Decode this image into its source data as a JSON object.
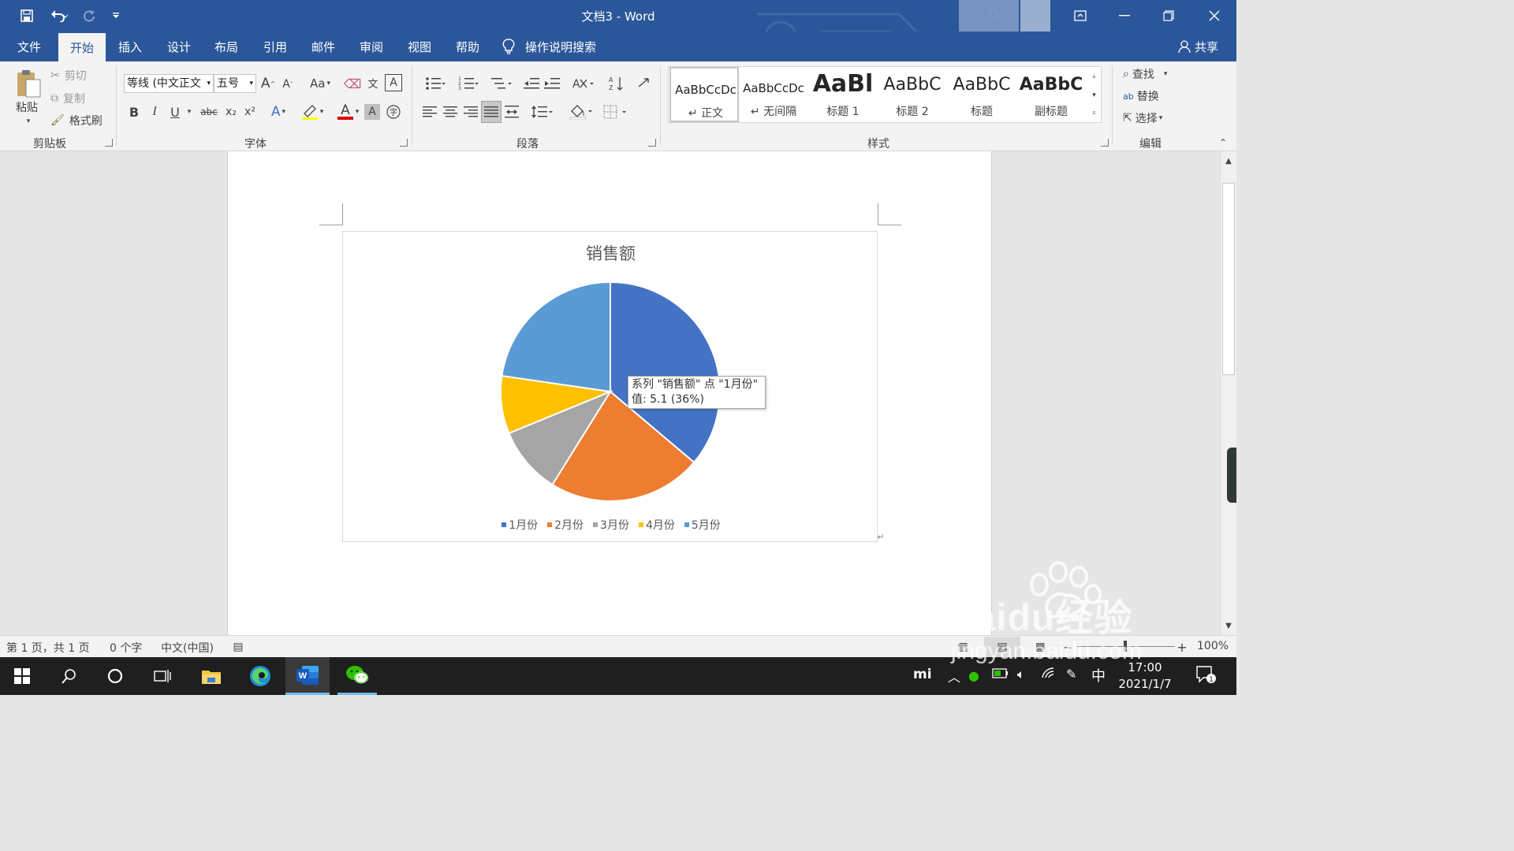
{
  "window": {
    "title": "文档3  -  Word",
    "qat": {
      "save_icon": "save-icon",
      "undo_icon": "undo-icon",
      "redo_icon": "redo-icon",
      "customize_icon": "chevron-down-icon"
    },
    "controls": {
      "ribbon_display": "ribbon-display-icon",
      "minimize": "minimize-icon",
      "restore": "restore-icon",
      "close": "close-icon"
    }
  },
  "tabs": [
    {
      "label": "文件"
    },
    {
      "label": "开始"
    },
    {
      "label": "插入"
    },
    {
      "label": "设计"
    },
    {
      "label": "布局"
    },
    {
      "label": "引用"
    },
    {
      "label": "邮件"
    },
    {
      "label": "审阅"
    },
    {
      "label": "视图"
    },
    {
      "label": "帮助"
    }
  ],
  "tell_me": "操作说明搜索",
  "share": "共享",
  "ribbon": {
    "clipboard": {
      "paste": "粘贴",
      "cut": "剪切",
      "copy": "复制",
      "format_painter": "格式刷",
      "label": "剪贴板"
    },
    "font": {
      "name": "等线 (中文正文",
      "size": "五号",
      "label": "字体",
      "bold": "B",
      "italic": "I",
      "underline": "U",
      "strike": "abc",
      "sub": "x₂",
      "sup": "x²",
      "change_case": "Aa",
      "grow": "A",
      "shrink": "A",
      "font_color_accent": "#e00000"
    },
    "paragraph": {
      "label": "段落"
    },
    "styles": {
      "label": "样式",
      "items": [
        {
          "sample": "AaBbCcDc",
          "name": "↵ 正文"
        },
        {
          "sample": "AaBbCcDc",
          "name": "↵ 无间隔"
        },
        {
          "sample": "AaBl",
          "name": "标题 1"
        },
        {
          "sample": "AaBbC",
          "name": "标题 2"
        },
        {
          "sample": "AaBbC",
          "name": "标题"
        },
        {
          "sample": "AaBbC",
          "name": "副标题"
        }
      ]
    },
    "editing": {
      "label": "编辑",
      "find": "查找",
      "replace": "替换",
      "select": "选择"
    }
  },
  "chart_data": {
    "type": "pie",
    "title": "销售额",
    "categories": [
      "1月份",
      "2月份",
      "3月份",
      "4月份",
      "5月份"
    ],
    "series": [
      {
        "name": "销售额",
        "values": [
          5.1,
          3.2,
          1.4,
          1.2,
          3.2
        ]
      }
    ],
    "colors": [
      "#4472c4",
      "#ed7d31",
      "#a5a5a5",
      "#ffc000",
      "#5b9bd5"
    ],
    "legend": "bottom",
    "tooltip": {
      "line1": "系列 \"销售额\" 点 \"1月份\"",
      "line2": "值: 5.1 (36%)"
    }
  },
  "status": {
    "page": "第 1 页，共 1 页",
    "words": "0 个字",
    "language": "中文(中国)",
    "zoom": "100%"
  },
  "taskbar": {
    "time": "17:00",
    "date": "2021/1/7",
    "ime": "中",
    "notification_count": "1"
  },
  "watermark": {
    "brand": "Baidu经验",
    "url": "jingyan.baidu.com"
  }
}
